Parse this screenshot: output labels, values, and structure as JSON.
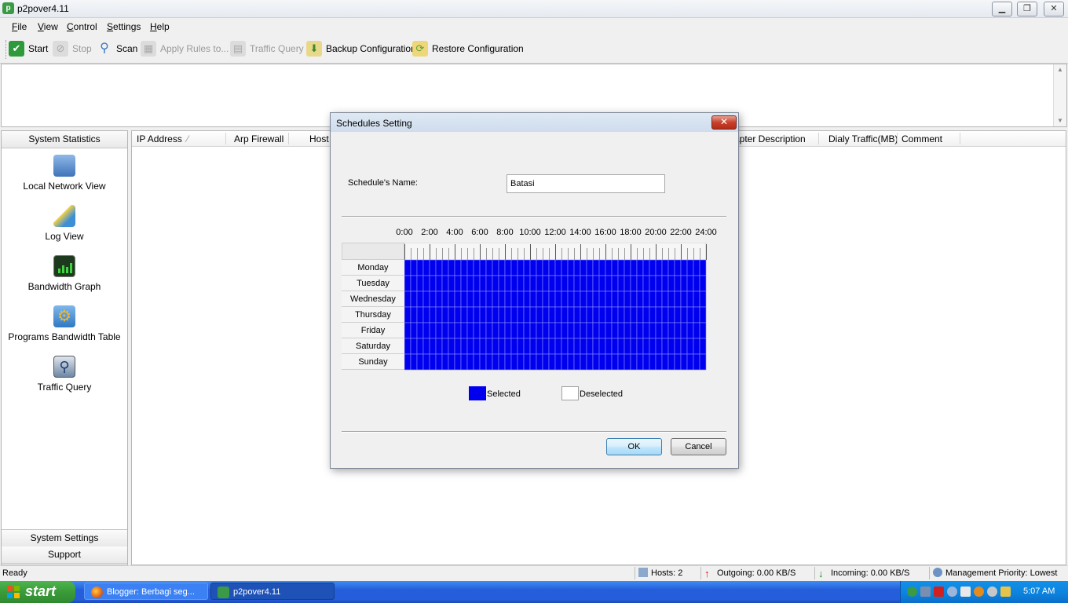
{
  "window": {
    "title": "p2pover4.11",
    "app_icon_glyph": "p"
  },
  "menu": [
    "File",
    "View",
    "Control",
    "Settings",
    "Help"
  ],
  "toolbar": [
    {
      "label": "Start",
      "icon": "check-icon",
      "enabled": true,
      "color": "#2e9a3c"
    },
    {
      "label": "Stop",
      "icon": "stop-icon",
      "enabled": false
    },
    {
      "label": "Scan",
      "icon": "magnifier-icon",
      "enabled": true,
      "color": "#3b78c2"
    },
    {
      "label": "Apply Rules to...",
      "icon": "rules-icon",
      "enabled": false
    },
    {
      "label": "Traffic Query",
      "icon": "traffic-query-icon",
      "enabled": false
    },
    {
      "label": "Backup Configuration",
      "icon": "backup-icon",
      "enabled": true,
      "color": "#6aa63a"
    },
    {
      "label": "Restore Configuration",
      "icon": "restore-icon",
      "enabled": true,
      "color": "#d9b23a"
    }
  ],
  "left_panel": {
    "header": "System Statistics",
    "items": [
      {
        "label": "Local Network View",
        "icon": "network-computers-icon",
        "color": "#4a86c8"
      },
      {
        "label": "Log View",
        "icon": "pencil-icon",
        "color": "#3e8fd6"
      },
      {
        "label": "Bandwidth Graph",
        "icon": "bandwidth-graph-icon",
        "color": "#1e3a1e"
      },
      {
        "label": "Programs Bandwidth Table",
        "icon": "gear-folder-icon",
        "color": "#3f8fd0"
      },
      {
        "label": "Traffic Query",
        "icon": "traffic-magnifier-icon",
        "color": "#5a6f8a"
      }
    ],
    "footer": [
      "System Settings",
      "Support"
    ]
  },
  "table": {
    "columns": [
      "IP Address",
      "Arp Firewall",
      "Host I",
      "apter Description",
      "Dialy Traffic(MB)",
      "Comment"
    ],
    "sort_indicator": "⁄"
  },
  "status": {
    "ready": "Ready",
    "hosts": "Hosts: 2",
    "outgoing": "Outgoing: 0.00 KB/S",
    "incoming": "Incoming: 0.00 KB/S",
    "priority": "Management Priority: Lowest"
  },
  "taskbar": {
    "start": "start",
    "tasks": [
      {
        "label": "Blogger: Berbagi seg...",
        "icon": "firefox-icon",
        "active": false
      },
      {
        "label": "p2pover4.11",
        "icon": "p2pover-icon",
        "active": true
      }
    ],
    "clock": "5:07 AM"
  },
  "dialog": {
    "title": "Schedules Setting",
    "close_glyph": "✕",
    "name_label": "Schedule's Name:",
    "name_value": "Batasi",
    "hour_labels": [
      "0:00",
      "2:00",
      "4:00",
      "6:00",
      "8:00",
      "10:00",
      "12:00",
      "14:00",
      "16:00",
      "18:00",
      "20:00",
      "22:00",
      "24:00"
    ],
    "days": [
      "Monday",
      "Tuesday",
      "Wednesday",
      "Thursday",
      "Friday",
      "Saturday",
      "Sunday"
    ],
    "slots_per_day": 48,
    "selected_all": true,
    "legend": {
      "selected": "Selected",
      "deselected": "Deselected"
    },
    "colors": {
      "selected": "#0000ee",
      "deselected": "#ffffff"
    },
    "ok": "OK",
    "cancel": "Cancel"
  }
}
